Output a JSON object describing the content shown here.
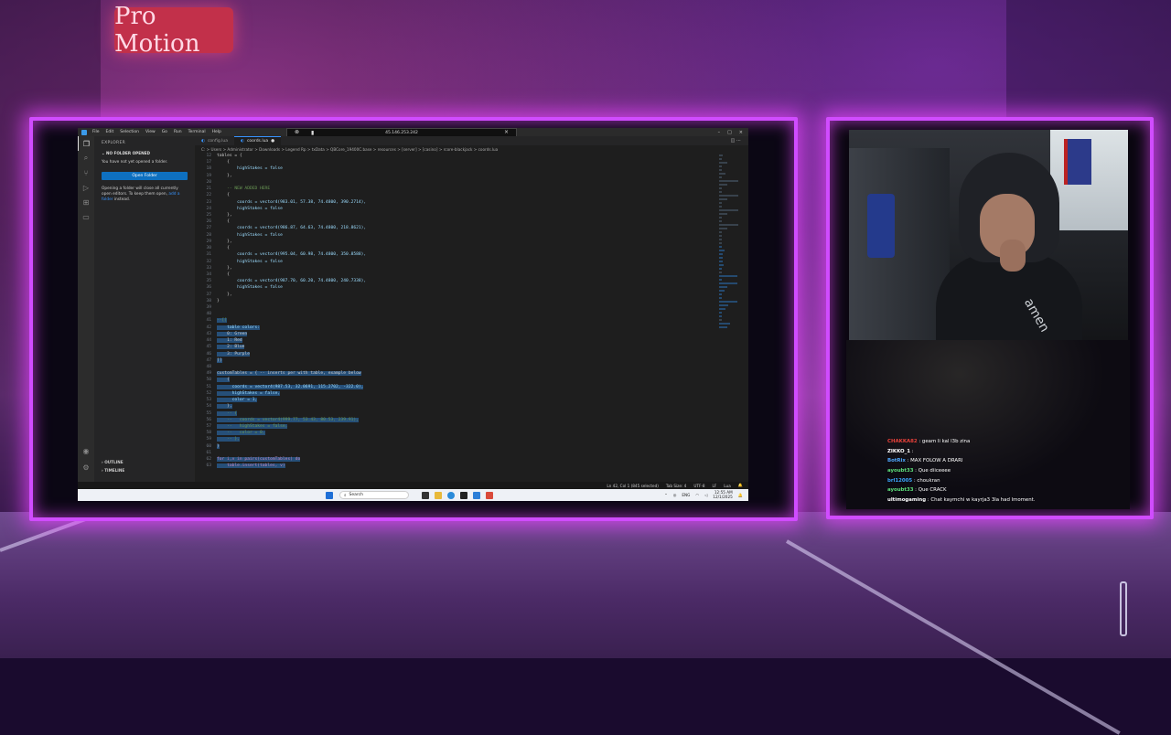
{
  "background": {
    "sign_text": "Pro Motion"
  },
  "vscode": {
    "menu": [
      "File",
      "Edit",
      "Selection",
      "View",
      "Go",
      "Run",
      "Terminal",
      "Help"
    ],
    "remote_address": "45.146.253.242",
    "explorer_title": "EXPLORER",
    "no_folder_header": "NO FOLDER OPENED",
    "no_folder_msg": "You have not yet opened a folder.",
    "open_folder_btn": "Open Folder",
    "open_folder_note": "Opening a folder will close all currently open editors. To keep them open,",
    "add_folder_link": "add a folder",
    "open_folder_note_end": "instead.",
    "outline": "OUTLINE",
    "timeline": "TIMELINE",
    "tabs": [
      {
        "label": "config.lua"
      },
      {
        "label": "coords.lua"
      }
    ],
    "breadcrumb": "C: > Users > Administrator > Downloads > Legend Rp > txData > QBCore_19400C.base > resources > [server] > [casino] > rcore-blackjack > coords.lua",
    "code_lines": [
      {
        "n": "12",
        "t": "tables = {",
        "sel": false
      },
      {
        "n": "17",
        "t": "    {",
        "sel": false
      },
      {
        "n": "18",
        "t": "        highStakes = false",
        "sel": false
      },
      {
        "n": "19",
        "t": "    },",
        "sel": false
      },
      {
        "n": "20",
        "t": "",
        "sel": false
      },
      {
        "n": "21",
        "t": "    -- NEW ADDED HERE",
        "sel": false
      },
      {
        "n": "22",
        "t": "    {",
        "sel": false
      },
      {
        "n": "23",
        "t": "        coords = vector4(983.01, 57.38, 74.4800, 390.2714),",
        "sel": false
      },
      {
        "n": "24",
        "t": "        highStakes = false",
        "sel": false
      },
      {
        "n": "25",
        "t": "    },",
        "sel": false
      },
      {
        "n": "26",
        "t": "    {",
        "sel": false
      },
      {
        "n": "27",
        "t": "        coords = vector4(986.87, 64.63, 74.4800, 218.8621),",
        "sel": false
      },
      {
        "n": "28",
        "t": "        highStakes = false",
        "sel": false
      },
      {
        "n": "29",
        "t": "    },",
        "sel": false
      },
      {
        "n": "30",
        "t": "    {",
        "sel": false
      },
      {
        "n": "31",
        "t": "        coords = vector4(995.04, 60.98, 74.4800, 350.8588),",
        "sel": false
      },
      {
        "n": "32",
        "t": "        highStakes = false",
        "sel": false
      },
      {
        "n": "33",
        "t": "    },",
        "sel": false
      },
      {
        "n": "34",
        "t": "    {",
        "sel": false
      },
      {
        "n": "35",
        "t": "        coords = vector4(987.70, 60.20, 74.4800, 240.7338),",
        "sel": false
      },
      {
        "n": "36",
        "t": "        highStakes = false",
        "sel": false
      },
      {
        "n": "37",
        "t": "    },",
        "sel": false
      },
      {
        "n": "38",
        "t": "}",
        "sel": false
      },
      {
        "n": "39",
        "t": "",
        "sel": false
      },
      {
        "n": "40",
        "t": "",
        "sel": false
      },
      {
        "n": "41",
        "t": "--[[",
        "sel": true
      },
      {
        "n": "42",
        "t": "    table colors:",
        "sel": true
      },
      {
        "n": "43",
        "t": "    0: Green",
        "sel": true
      },
      {
        "n": "44",
        "t": "    1: Red",
        "sel": true
      },
      {
        "n": "45",
        "t": "    2: Blue",
        "sel": true
      },
      {
        "n": "46",
        "t": "    3: Purple",
        "sel": true
      },
      {
        "n": "47",
        "t": "]]",
        "sel": true
      },
      {
        "n": "48",
        "t": "",
        "sel": false
      },
      {
        "n": "49",
        "t": "customTables = { -- inserts per with table, example below",
        "sel": true
      },
      {
        "n": "50",
        "t": "    {",
        "sel": true
      },
      {
        "n": "51",
        "t": "      coords = vector4(987.53, 32.0691, 115.2702, -322.0),",
        "sel": true
      },
      {
        "n": "52",
        "t": "      highStakes = false,",
        "sel": true
      },
      {
        "n": "53",
        "t": "      color = 1,",
        "sel": true
      },
      {
        "n": "54",
        "t": "    },",
        "sel": true
      },
      {
        "n": "55",
        "t": "    -- {",
        "sel": true
      },
      {
        "n": "56",
        "t": "    --   coords = vector4(999.77, 53.43, 80.53, 239.91),",
        "sel": true
      },
      {
        "n": "57",
        "t": "    --   highStakes = false,",
        "sel": true
      },
      {
        "n": "58",
        "t": "    --   color = 0,",
        "sel": true
      },
      {
        "n": "59",
        "t": "    -- },",
        "sel": true
      },
      {
        "n": "60",
        "t": "}",
        "sel": true
      },
      {
        "n": "61",
        "t": "",
        "sel": false
      },
      {
        "n": "62",
        "t": "for i,v in pairs(customTables) do",
        "sel": true
      },
      {
        "n": "63",
        "t": "    table.insert(tables, v)",
        "sel": true
      }
    ],
    "status": {
      "position": "Ln 42, Col 1 (845 selected)",
      "tab": "Tab Size: 4",
      "encoding": "UTF-8",
      "eol": "LF",
      "lang": "Lua"
    },
    "taskbar": {
      "search": "Search",
      "lang": "ENG",
      "time": "12:55 AM",
      "date": "12/1/2025"
    }
  },
  "chat": [
    {
      "user": "CHAKKA82",
      "msg": "geam li kal l3b zina",
      "color": "#e8413a"
    },
    {
      "user": "ZIKKO_1",
      "msg": "",
      "color": "#ffffff"
    },
    {
      "user": "BotRix",
      "msg": "MAX FOLOW A DRARI",
      "color": "#4fa8ff"
    },
    {
      "user": "ayoubt33",
      "msg": "Que diiceeee",
      "color": "#5de07a"
    },
    {
      "user": "brl12005",
      "msg": "choukran",
      "color": "#3ba8ff"
    },
    {
      "user": "ayoubt33",
      "msg": "Que CRACK",
      "color": "#5de07a"
    },
    {
      "user": "ultimogaming",
      "msg": "Chat kaymchi w kayrja3 3la had lmoment.",
      "color": "#ffffff"
    }
  ],
  "webcam": {
    "hoodie_text": "amen"
  }
}
